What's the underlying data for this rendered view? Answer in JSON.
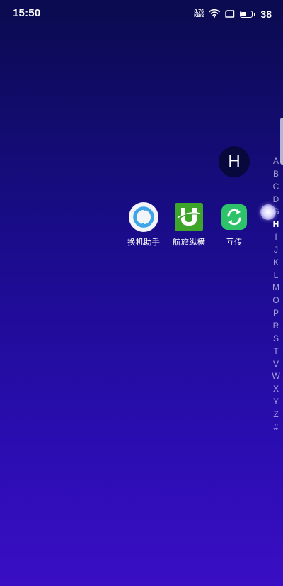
{
  "status_bar": {
    "time": "15:50",
    "net_speed_value": "8.76",
    "net_speed_unit": "KB/S",
    "battery_level": "38",
    "wifi_icon": "wifi-icon",
    "sim_icon": "sim-icon",
    "battery_icon": "battery-icon"
  },
  "current_letter": "H",
  "apps": [
    {
      "label": "换机助手",
      "icon": "phone-clone-icon"
    },
    {
      "label": "航旅纵横",
      "icon": "umetrip-icon"
    },
    {
      "label": "互传",
      "icon": "transfer-icon"
    }
  ],
  "index": {
    "letters": [
      "A",
      "B",
      "C",
      "D",
      "G",
      "H",
      "I",
      "J",
      "K",
      "L",
      "M",
      "O",
      "P",
      "R",
      "S",
      "T",
      "V",
      "W",
      "X",
      "Y",
      "Z",
      "#"
    ],
    "active": "H"
  },
  "colors": {
    "bg_top": "#0a0b4f",
    "bg_bottom": "#3a0ec4",
    "bubble": "#07093c",
    "umetrip_green": "#3da62a",
    "transfer_green": "#2ec26a",
    "clone_blue": "#3ea5e8"
  }
}
